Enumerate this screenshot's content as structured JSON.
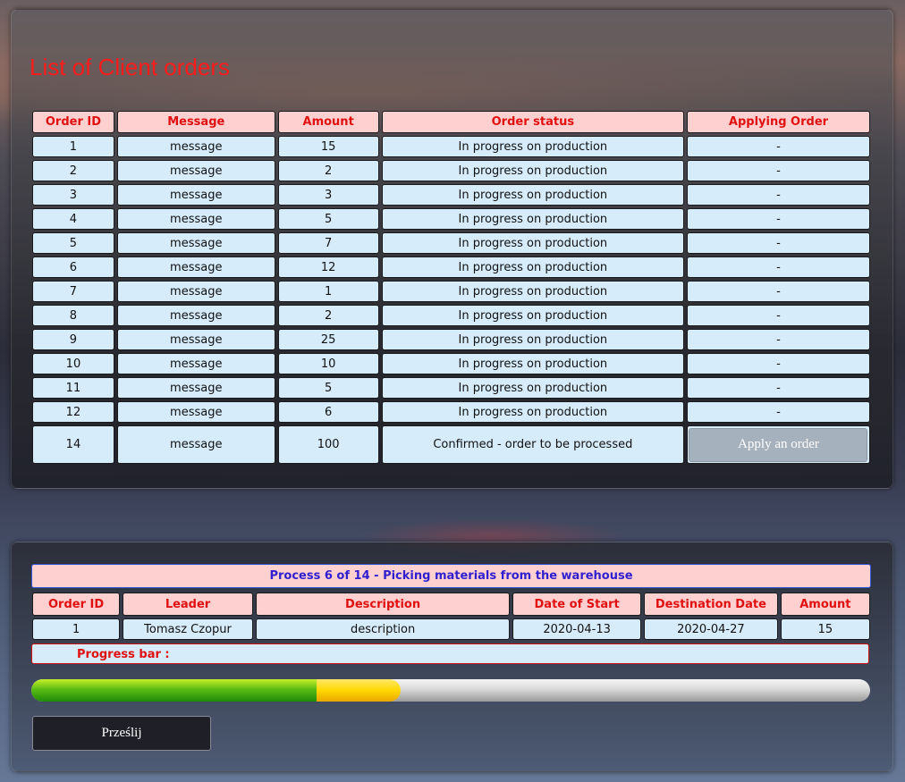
{
  "page": {
    "title": "List of Client orders"
  },
  "orders": {
    "headers": [
      "Order ID",
      "Message",
      "Amount",
      "Order status",
      "Applying Order"
    ],
    "rows": [
      {
        "id": "1",
        "message": "message",
        "amount": "15",
        "status": "In progress on production",
        "applying": "-"
      },
      {
        "id": "2",
        "message": "message",
        "amount": "2",
        "status": "In progress on production",
        "applying": "-"
      },
      {
        "id": "3",
        "message": "message",
        "amount": "3",
        "status": "In progress on production",
        "applying": "-"
      },
      {
        "id": "4",
        "message": "message",
        "amount": "5",
        "status": "In progress on production",
        "applying": "-"
      },
      {
        "id": "5",
        "message": "message",
        "amount": "7",
        "status": "In progress on production",
        "applying": "-"
      },
      {
        "id": "6",
        "message": "message",
        "amount": "12",
        "status": "In progress on production",
        "applying": "-"
      },
      {
        "id": "7",
        "message": "message",
        "amount": "1",
        "status": "In progress on production",
        "applying": "-"
      },
      {
        "id": "8",
        "message": "message",
        "amount": "2",
        "status": "In progress on production",
        "applying": "-"
      },
      {
        "id": "9",
        "message": "message",
        "amount": "25",
        "status": "In progress on production",
        "applying": "-"
      },
      {
        "id": "10",
        "message": "message",
        "amount": "10",
        "status": "In progress on production",
        "applying": "-"
      },
      {
        "id": "11",
        "message": "message",
        "amount": "5",
        "status": "In progress on production",
        "applying": "-"
      },
      {
        "id": "12",
        "message": "message",
        "amount": "6",
        "status": "In progress on production",
        "applying": "-"
      }
    ],
    "last_row": {
      "id": "14",
      "message": "message",
      "amount": "100",
      "status": "Confirmed - order to be processed",
      "button_label": "Apply an order"
    }
  },
  "process": {
    "header": "Process 6 of 14 - Picking materials from the warehouse",
    "headers": [
      "Order ID",
      "Leader",
      "Description",
      "Date of Start",
      "Destination Date",
      "Amount"
    ],
    "row": {
      "id": "1",
      "leader": "Tomasz Czopur",
      "description": "description",
      "start": "2020-04-13",
      "destination": "2020-04-27",
      "amount": "15"
    },
    "progress_label": "Progress bar :",
    "progress": {
      "completed_fraction": 0.34,
      "current_fraction": 0.1,
      "completed_color": "#3fa80f",
      "current_color": "#ffd800"
    },
    "submit_label": "Prześlij"
  },
  "colors": {
    "title": "#ff1a1a",
    "header_bg": "#ffd0d0",
    "header_text": "#e01010",
    "cell_bg": "#d6ecfb",
    "process_text": "#2f1fd0"
  }
}
